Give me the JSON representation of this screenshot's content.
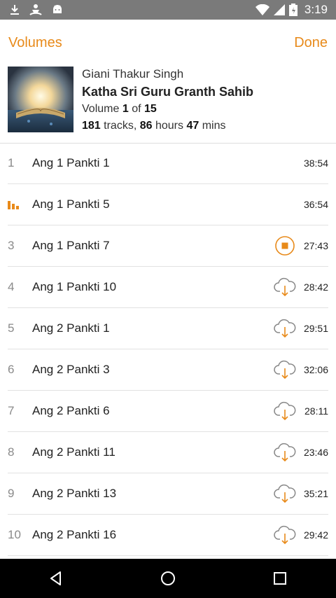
{
  "status_bar": {
    "time": "3:19",
    "icons": [
      "download-icon",
      "meditation-icon",
      "android-icon",
      "wifi-icon",
      "signal-icon",
      "battery-icon"
    ]
  },
  "header": {
    "left_label": "Volumes",
    "right_label": "Done",
    "accent_color": "#e88a1a"
  },
  "album": {
    "artist": "Giani Thakur Singh",
    "title": "Katha Sri Guru Granth Sahib",
    "volume_prefix": "Volume",
    "volume_current": "1",
    "volume_of": "of",
    "volume_total": "15",
    "tracks_count": "181",
    "tracks_label": "tracks,",
    "hours": "86",
    "hours_label": "hours",
    "mins": "47",
    "mins_label": "mins"
  },
  "tracks": [
    {
      "num": "1",
      "name": "Ang 1 Pankti 1",
      "duration": "38:54",
      "state": "none"
    },
    {
      "num": "",
      "name": "Ang 1 Pankti 5",
      "duration": "36:54",
      "state": "playing"
    },
    {
      "num": "3",
      "name": "Ang 1 Pankti 7",
      "duration": "27:43",
      "state": "stop-download"
    },
    {
      "num": "4",
      "name": "Ang 1 Pankti 10",
      "duration": "28:42",
      "state": "download"
    },
    {
      "num": "5",
      "name": "Ang 2 Pankti 1",
      "duration": "29:51",
      "state": "download"
    },
    {
      "num": "6",
      "name": "Ang 2 Pankti 3",
      "duration": "32:06",
      "state": "download"
    },
    {
      "num": "7",
      "name": "Ang 2 Pankti 6",
      "duration": "28:11",
      "state": "download"
    },
    {
      "num": "8",
      "name": "Ang 2 Pankti 11",
      "duration": "23:46",
      "state": "download"
    },
    {
      "num": "9",
      "name": "Ang 2 Pankti 13",
      "duration": "35:21",
      "state": "download"
    },
    {
      "num": "10",
      "name": "Ang 2 Pankti 16",
      "duration": "29:42",
      "state": "download"
    }
  ],
  "navbar": {
    "icons": [
      "back-icon",
      "home-icon",
      "recents-icon"
    ]
  }
}
